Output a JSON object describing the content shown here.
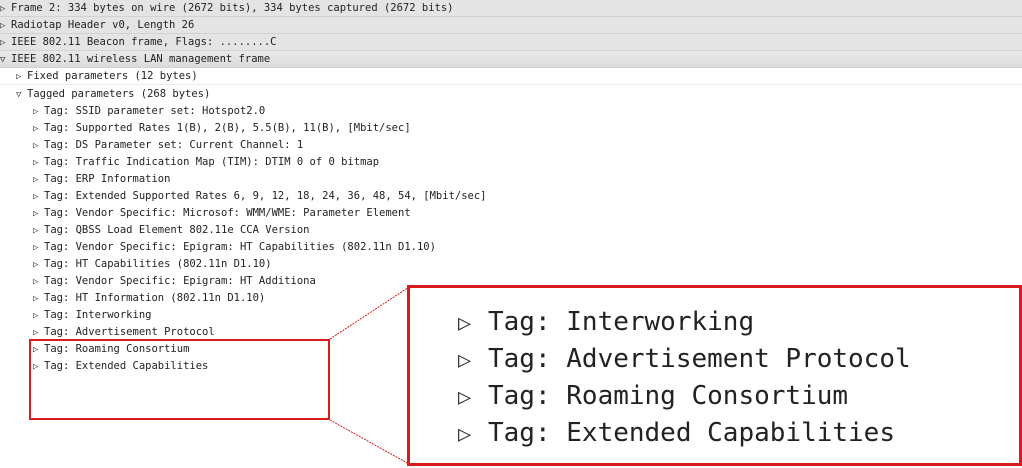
{
  "expander": {
    "collapsed": "▷",
    "expanded": "▽"
  },
  "tree": {
    "top_level": [
      {
        "text": "Frame 2: 334 bytes on wire (2672 bits), 334 bytes captured (2672 bits)",
        "expanded": false
      },
      {
        "text": "Radiotap Header v0, Length 26",
        "expanded": false
      },
      {
        "text": "IEEE 802.11 Beacon frame, Flags: ........C",
        "expanded": false
      },
      {
        "text": "IEEE 802.11 wireless LAN management frame",
        "expanded": true
      }
    ],
    "fixed_parameters": "Fixed parameters (12 bytes)",
    "tagged_parameters": "Tagged parameters (268 bytes)",
    "tags": [
      "Tag: SSID parameter set: Hotspot2.0",
      "Tag: Supported Rates 1(B), 2(B), 5.5(B), 11(B), [Mbit/sec]",
      "Tag: DS Parameter set: Current Channel: 1",
      "Tag: Traffic Indication Map (TIM): DTIM 0 of 0 bitmap",
      "Tag: ERP Information",
      "Tag: Extended Supported Rates 6, 9, 12, 18, 24, 36, 48, 54, [Mbit/sec]",
      "Tag: Vendor Specific: Microsof: WMM/WME: Parameter Element",
      "Tag: QBSS Load Element 802.11e CCA Version",
      "Tag: Vendor Specific: Epigram: HT Capabilities (802.11n D1.10)",
      "Tag: HT Capabilities (802.11n D1.10)",
      "Tag: Vendor Specific: Epigram: HT Additiona",
      "Tag: HT Information (802.11n D1.10)",
      "Tag: Interworking",
      "Tag: Advertisement Protocol",
      "Tag: Roaming Consortium",
      "Tag: Extended Capabilities"
    ]
  },
  "zoom": {
    "rows": [
      "Tag: Interworking",
      "Tag: Advertisement Protocol",
      "Tag: Roaming Consortium",
      "Tag: Extended Capabilities"
    ]
  },
  "colors": {
    "highlight": "#d81b1b",
    "row_band": "#e4e4e4"
  }
}
